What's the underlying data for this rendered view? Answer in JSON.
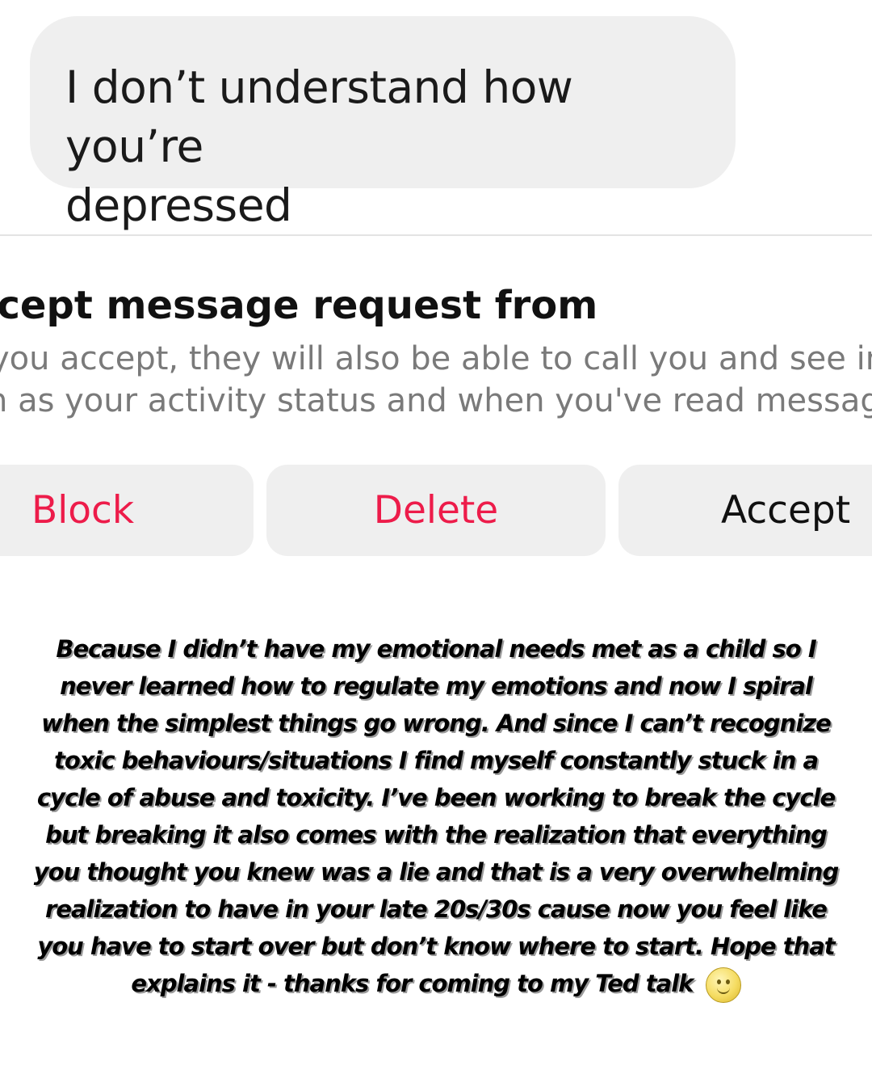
{
  "message": {
    "text_line1": "I don’t understand how you’re",
    "text_line2": "depressed"
  },
  "request": {
    "title": "ccept message request from",
    "desc_line1": "you accept, they will also be able to call you and see in",
    "desc_line2": "n as your activity status and when you've read messag"
  },
  "actions": {
    "block_label": "Block",
    "delete_label": "Delete",
    "accept_label": "Accept",
    "destructive_color": "#ed1c4a"
  },
  "caption": {
    "text": "Because I didn’t have my emotional needs met as a child so I never learned how to regulate my emotions and now I spiral when the simplest things go wrong. And since I can’t recognize toxic behaviours/situations I find myself constantly stuck in a cycle of abuse and toxicity. I’ve been working to break the cycle but breaking it also comes with the realization that everything you thought you knew was a lie and that is a very overwhelming realization to have in your late 20s/30s cause now you feel like you have to start over but don’t know where to start. Hope that explains it - thanks for coming to my Ted talk",
    "emoji": "smiling-face-emoji"
  }
}
